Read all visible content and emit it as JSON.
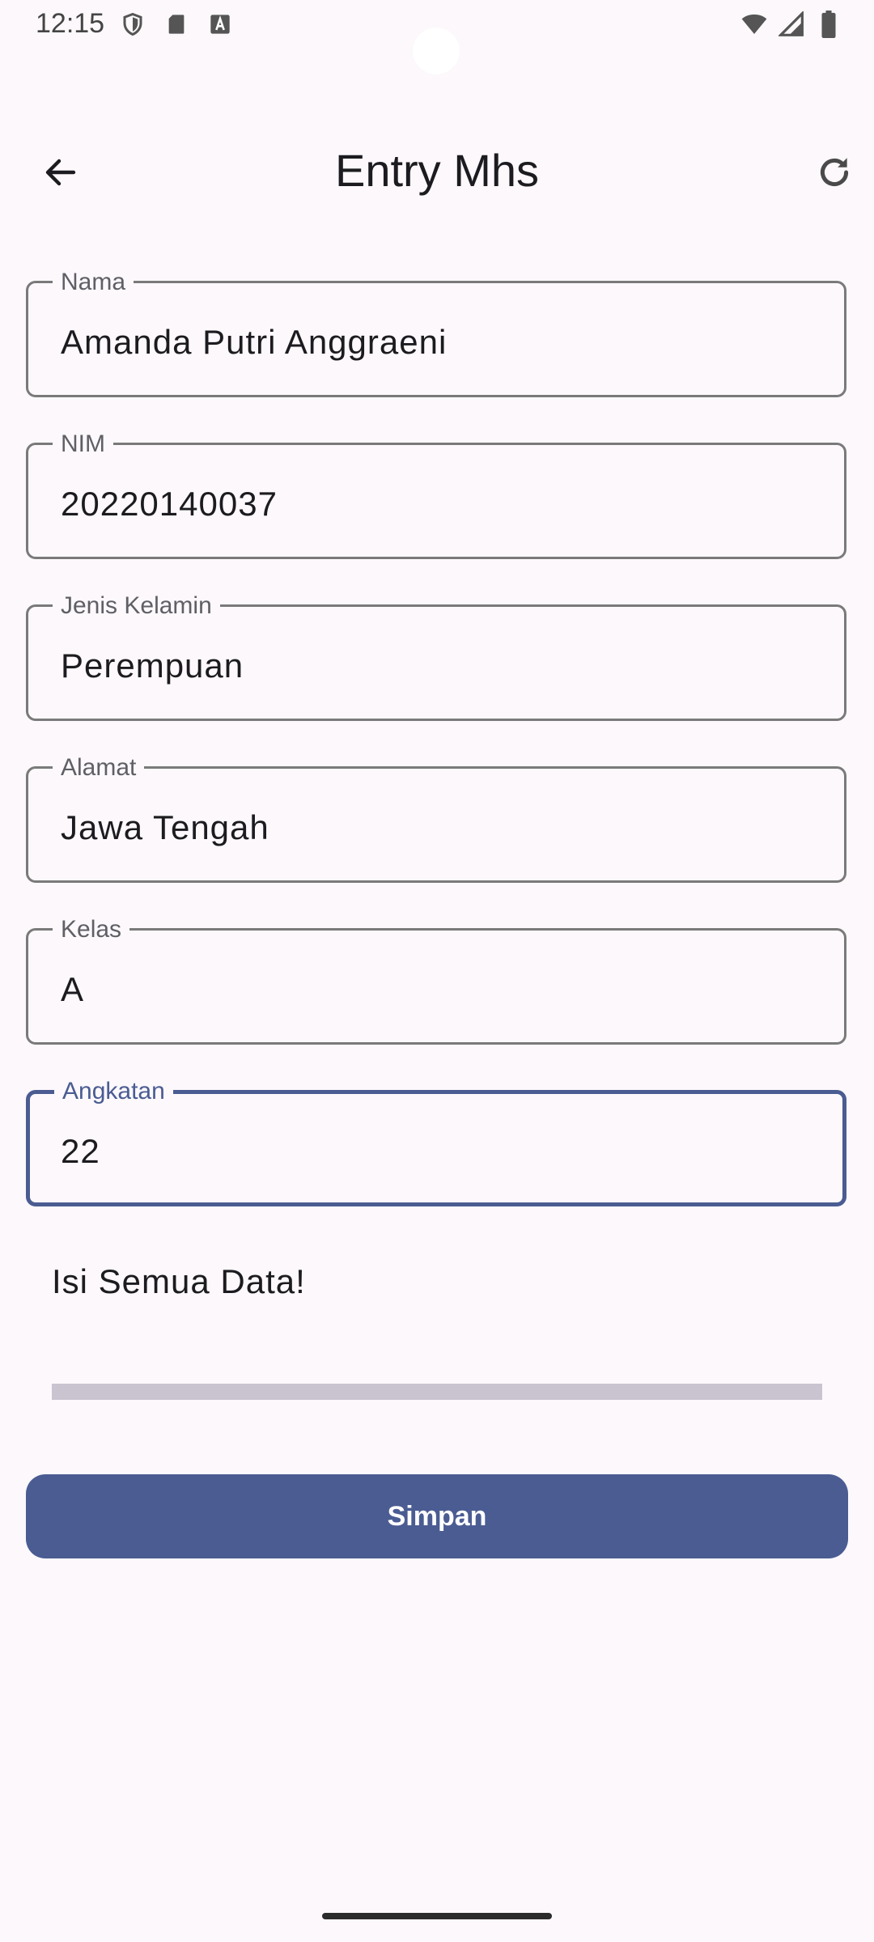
{
  "status_bar": {
    "time": "12:15",
    "left_icons": [
      "shield-icon",
      "sd-card-icon",
      "font-a-icon"
    ],
    "right_icons": [
      "wifi-icon",
      "cell-signal-icon",
      "battery-icon"
    ]
  },
  "app_bar": {
    "title": "Entry Mhs",
    "back_icon": "arrow-back-icon",
    "refresh_icon": "refresh-icon"
  },
  "form": {
    "fields": [
      {
        "label": "Nama",
        "value": "Amanda Putri Anggraeni"
      },
      {
        "label": "NIM",
        "value": "20220140037"
      },
      {
        "label": "Jenis Kelamin",
        "value": "Perempuan"
      },
      {
        "label": "Alamat",
        "value": "Jawa Tengah"
      },
      {
        "label": "Kelas",
        "value": "A"
      },
      {
        "label": "Angkatan",
        "value": "22",
        "focused": true
      }
    ],
    "message": "Isi Semua Data!",
    "progress": 0,
    "save_label": "Simpan"
  },
  "colors": {
    "primary": "#4a5c92",
    "background": "#fcf8fb",
    "outline": "#7a7a7a",
    "track": "#cac4d0"
  }
}
